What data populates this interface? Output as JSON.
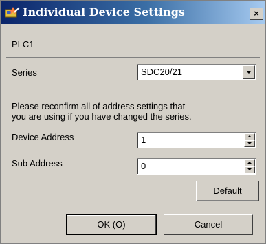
{
  "window": {
    "title": "Individual Device Settings",
    "close_glyph": "×"
  },
  "device_name": "PLC1",
  "series": {
    "label": "Series",
    "value": "SDC20/21"
  },
  "note": {
    "line1": "Please reconfirm all of address settings that",
    "line2": "you are using if you have changed the series."
  },
  "device_address": {
    "label": "Device Address",
    "value": "1"
  },
  "sub_address": {
    "label": "Sub Address",
    "value": "0"
  },
  "buttons": {
    "default": "Default",
    "ok": "OK (O)",
    "cancel": "Cancel"
  },
  "icons": {
    "title": "settings-wand-icon",
    "combo_arrow": "chevron-down-icon",
    "spin_up": "spin-up-icon",
    "spin_down": "spin-down-icon"
  }
}
